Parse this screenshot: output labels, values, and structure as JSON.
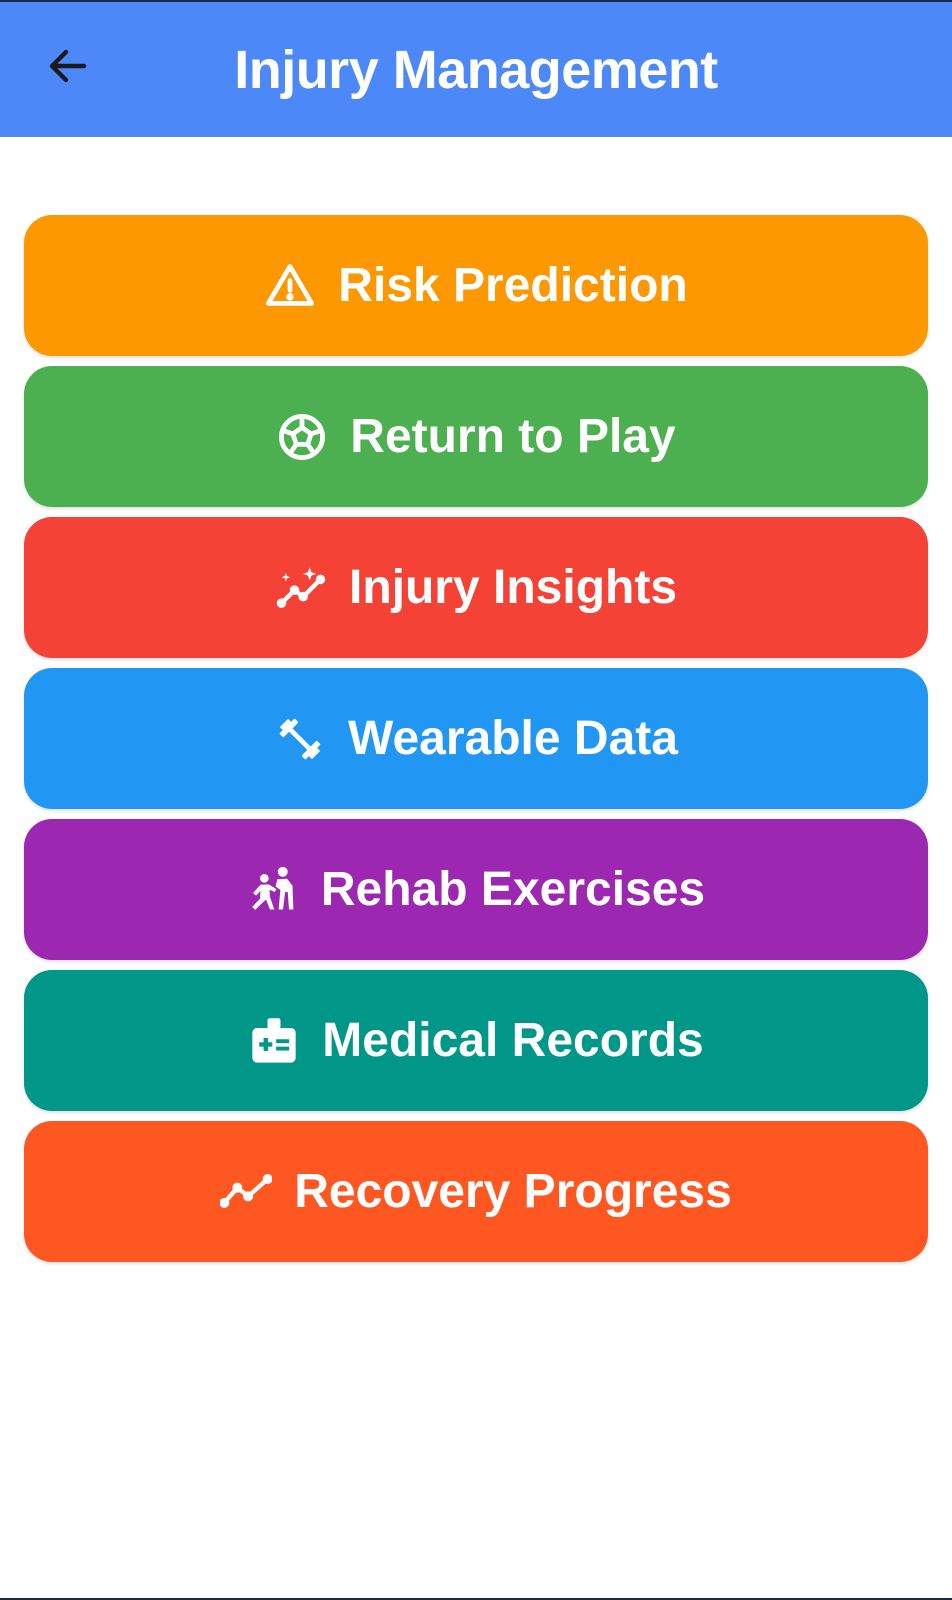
{
  "app_bar": {
    "title": "Injury Management",
    "back_icon": "arrow-left-icon",
    "background": "#4c88f7"
  },
  "menu": {
    "items": [
      {
        "label": "Risk Prediction",
        "icon": "warning-triangle-icon",
        "color": "#fe9800"
      },
      {
        "label": "Return to Play",
        "icon": "soccer-ball-icon",
        "color": "#4caf50"
      },
      {
        "label": "Injury Insights",
        "icon": "sparkle-trend-icon",
        "color": "#f44336"
      },
      {
        "label": "Wearable Data",
        "icon": "dumbbell-icon",
        "color": "#2196f3"
      },
      {
        "label": "Rehab Exercises",
        "icon": "assisting-person-icon",
        "color": "#9c27b0"
      },
      {
        "label": "Medical Records",
        "icon": "medical-kit-icon",
        "color": "#009688"
      },
      {
        "label": "Recovery Progress",
        "icon": "trend-line-icon",
        "color": "#ff5722"
      }
    ]
  }
}
